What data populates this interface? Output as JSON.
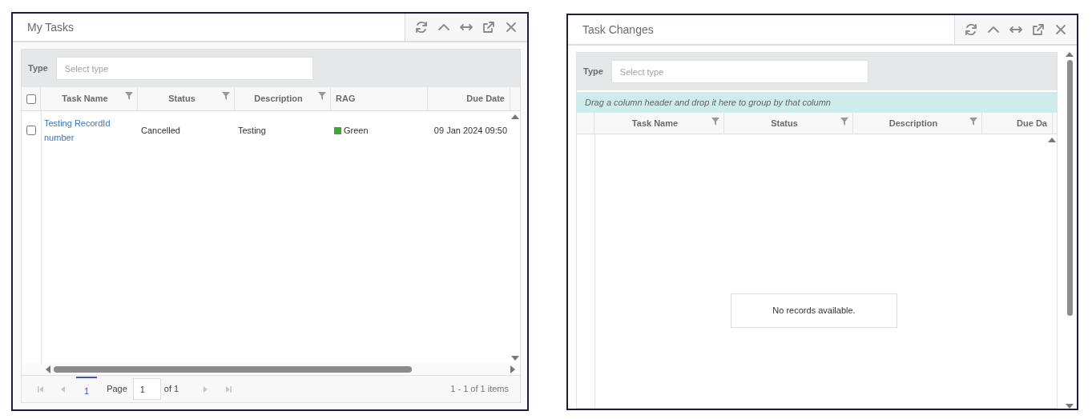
{
  "panels": [
    {
      "title": "My Tasks",
      "filter": {
        "label": "Type",
        "placeholder": "Select type"
      },
      "select_all": {
        "checked": false
      },
      "columns": [
        {
          "label": "Task Name",
          "filterable": true
        },
        {
          "label": "Status",
          "filterable": true
        },
        {
          "label": "Description",
          "filterable": true
        },
        {
          "label": "RAG",
          "filterable": false
        },
        {
          "label": "Due Date",
          "filterable": false
        }
      ],
      "rows": [
        {
          "checked": false,
          "cells": [
            {
              "kind": "link",
              "text": "Testing RecordId number"
            },
            {
              "kind": "text",
              "text": "Cancelled"
            },
            {
              "kind": "text",
              "text": "Testing"
            },
            {
              "kind": "status",
              "text": "Green",
              "color": "#3aaa35"
            },
            {
              "kind": "text",
              "text": "09 Jan 2024 09:50"
            }
          ]
        }
      ],
      "pager": {
        "nav_before": [
          {
            "kind": "first",
            "disabled": true
          },
          {
            "kind": "prev",
            "disabled": true
          }
        ],
        "pages": [
          {
            "label": "1",
            "selected": true
          }
        ],
        "page_label": "Page",
        "page_value": "1",
        "of_label": "of 1",
        "nav_after": [
          {
            "kind": "next",
            "disabled": true
          },
          {
            "kind": "last",
            "disabled": true
          }
        ],
        "summary": "1 - 1 of 1 items"
      }
    },
    {
      "title": "Task Changes",
      "filter": {
        "label": "Type",
        "placeholder": "Select type"
      },
      "group_hint": "Drag a column header and drop it here to group by that column",
      "columns": [
        {
          "label": "Task Name",
          "filterable": true
        },
        {
          "label": "Status",
          "filterable": true
        },
        {
          "label": "Description",
          "filterable": true
        },
        {
          "label": "Due Da",
          "filterable": false
        }
      ],
      "empty_message": "No records available."
    }
  ]
}
